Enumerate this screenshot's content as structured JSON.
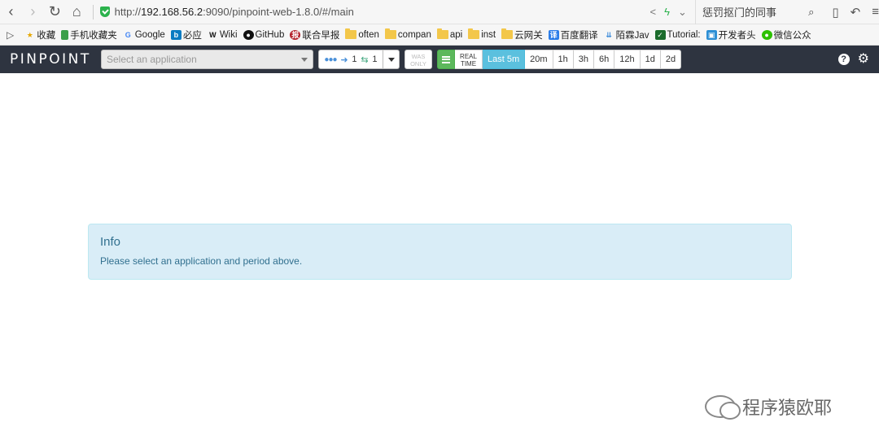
{
  "browser": {
    "url_scheme": "http://",
    "url_host": "192.168.56.2",
    "url_rest": ":9090/pinpoint-web-1.8.0/#/main",
    "search_text": "惩罚抠门的同事"
  },
  "bookmarks": [
    {
      "label": "收藏",
      "icon": "star-icon"
    },
    {
      "label": "手机收藏夹",
      "icon": "phone-icon"
    },
    {
      "label": "Google",
      "icon": "google-icon"
    },
    {
      "label": "必应",
      "icon": "bing-icon"
    },
    {
      "label": "Wiki",
      "icon": "wikipedia-icon"
    },
    {
      "label": "GitHub",
      "icon": "github-icon"
    },
    {
      "label": "联合早报",
      "icon": "zaobao-icon"
    },
    {
      "label": "often",
      "icon": "folder-icon"
    },
    {
      "label": "compan",
      "icon": "folder-icon"
    },
    {
      "label": "api",
      "icon": "folder-icon"
    },
    {
      "label": "inst",
      "icon": "folder-icon"
    },
    {
      "label": "云网关",
      "icon": "folder-icon"
    },
    {
      "label": "百度翻译",
      "icon": "translate-icon"
    },
    {
      "label": "陌霖Jav",
      "icon": "bookmark-icon"
    },
    {
      "label": "Tutorial:",
      "icon": "tutorial-icon"
    },
    {
      "label": "开发者头",
      "icon": "dev-icon"
    },
    {
      "label": "微信公众",
      "icon": "wechat-icon"
    }
  ],
  "pinpoint": {
    "logo": "PINPOINT",
    "app_select_placeholder": "Select an application",
    "agent_in_count": "1",
    "agent_out_count": "1",
    "was_only_line1": "WAS",
    "was_only_line2": "ONLY",
    "real_time_line1": "REAL",
    "real_time_line2": "TIME",
    "periods": [
      "Last 5m",
      "20m",
      "1h",
      "3h",
      "6h",
      "12h",
      "1d",
      "2d"
    ],
    "active_period": "Last 5m"
  },
  "info": {
    "title": "Info",
    "message": "Please select an application and period above."
  },
  "watermark": {
    "text": "程序猿欧耶"
  }
}
